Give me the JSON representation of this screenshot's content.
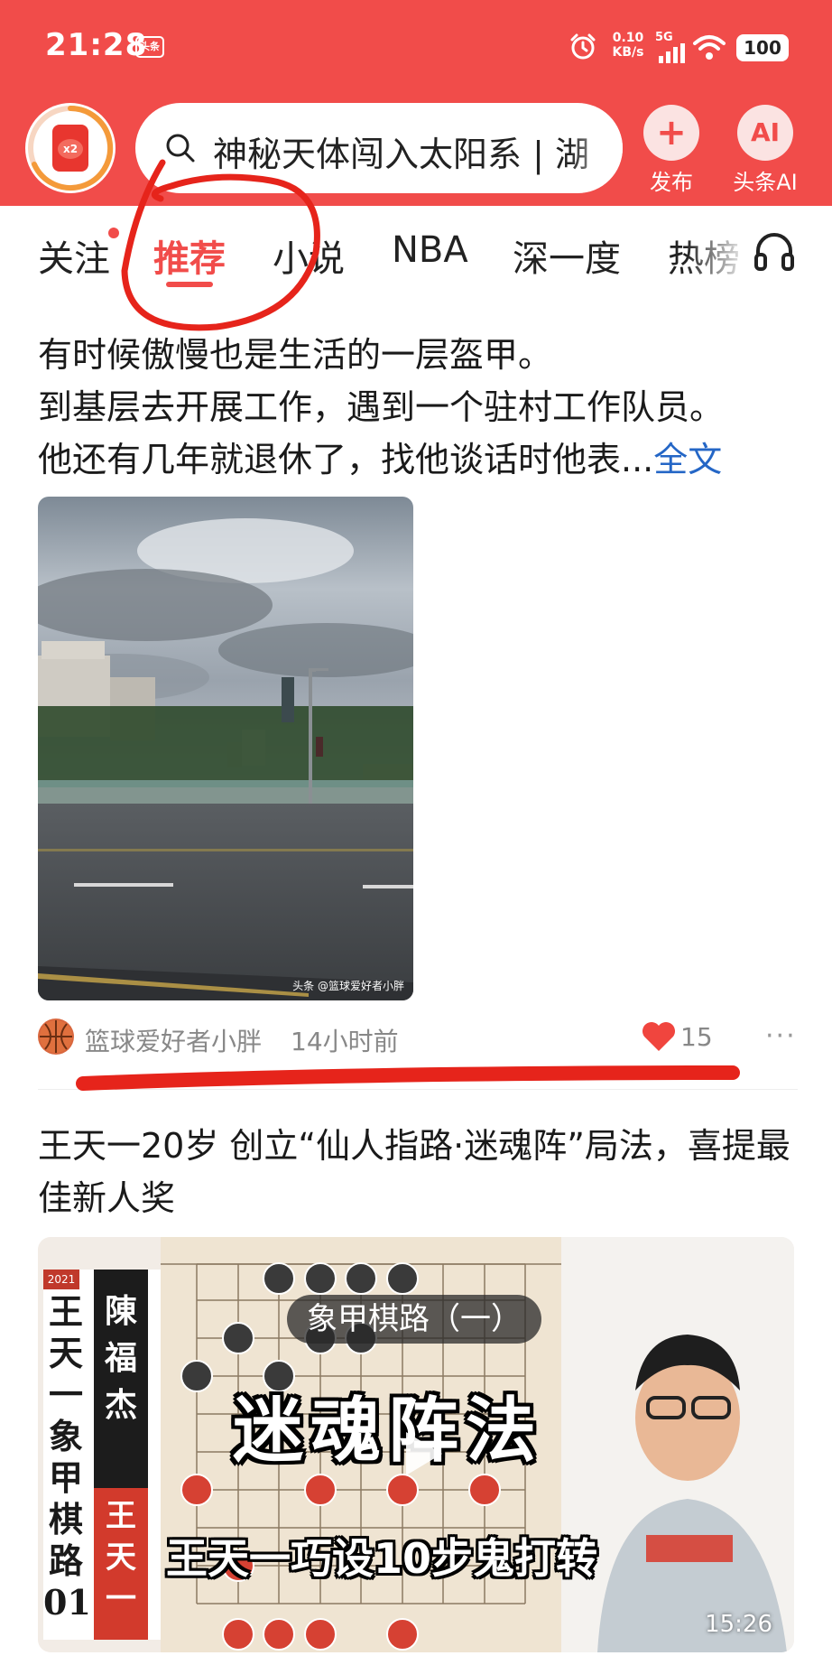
{
  "status_bar": {
    "time": "21:28",
    "app_badge": "头条",
    "net_speed_value": "0.10",
    "net_speed_unit": "KB/s",
    "network": "5G",
    "battery": "100"
  },
  "header": {
    "avatar_badge": "x2",
    "search_query": "神秘天体闯入太阳系 | 湖",
    "publish_label": "发布",
    "publish_icon": "+",
    "ai_icon": "AI",
    "ai_label": "头条AI"
  },
  "tabs": [
    {
      "label": "关注",
      "active": false
    },
    {
      "label": "推荐",
      "active": true
    },
    {
      "label": "小说",
      "active": false
    },
    {
      "label": "NBA",
      "active": false
    },
    {
      "label": "深一度",
      "active": false
    },
    {
      "label": "热榜",
      "active": false
    }
  ],
  "feed": {
    "post": {
      "line1": "有时候傲慢也是生活的一层盔甲。",
      "line2": "到基层去开展工作，遇到一个驻村工作队员。",
      "line3": "他还有几年就退休了，找他谈话时他表...",
      "more_link": "全文",
      "image_watermark": "头条 @篮球爱好者小胖",
      "author": "篮球爱好者小胖",
      "time": "14小时前",
      "likes": "15",
      "more_icon": "···"
    },
    "article": {
      "title": "王天一20岁 创立“仙人指路·迷魂阵”局法，喜提最佳新人奖",
      "video": {
        "banner_year": "2021",
        "left_column": "王天一象甲棋路01",
        "name_top": "陳福杰",
        "name_bottom": "王天一",
        "board_caption": "象甲棋路（一）",
        "big_caption": "迷魂阵法",
        "sub_caption": "王天一巧设10步鬼打转",
        "duration": "15:26"
      }
    }
  },
  "colors": {
    "brand_red": "#f14c4a",
    "link_blue": "#2466c6",
    "meta_gray": "#888888"
  },
  "icons": {
    "search": "search-icon",
    "headphone": "headphone-icon",
    "heart": "heart-icon",
    "play": "play-icon"
  }
}
